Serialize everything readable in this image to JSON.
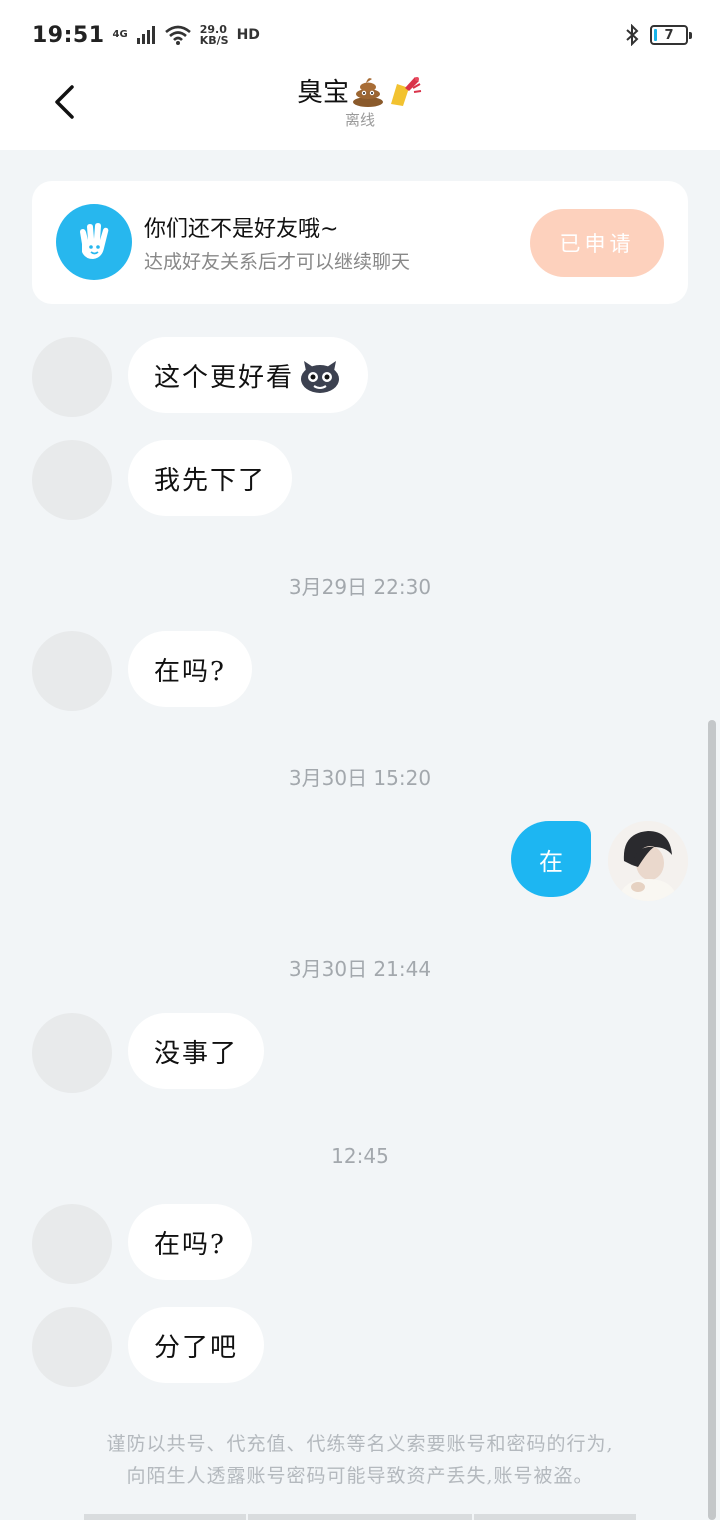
{
  "status_bar": {
    "time": "19:51",
    "network": "4G",
    "speed_value": "29.0",
    "speed_unit": "KB/S",
    "hd": "HD",
    "battery": "7"
  },
  "header": {
    "title": "臭宝",
    "status": "离线"
  },
  "friend_card": {
    "title": "你们还不是好友哦~",
    "subtitle": "达成好友关系后才可以继续聊天",
    "button": "已申请"
  },
  "messages": {
    "m1": "这个更好看",
    "m2": "我先下了",
    "t1": "3月29日  22:30",
    "m3": "在吗?",
    "t2": "3月30日  15:20",
    "my1": "在",
    "t3": "3月30日  21:44",
    "m4": "没事了",
    "t4": "12:45",
    "m5": "在吗?",
    "m6": "分了吧"
  },
  "notice": {
    "line1": "谨防以共号、代充值、代练等名义索要账号和密码的行为,",
    "line2": "向陌生人透露账号密码可能导致资产丢失,账号被盗。"
  },
  "colors": {
    "accent": "#1db6f2",
    "apply_button": "#fdd1bd",
    "background": "#f2f5f7"
  }
}
